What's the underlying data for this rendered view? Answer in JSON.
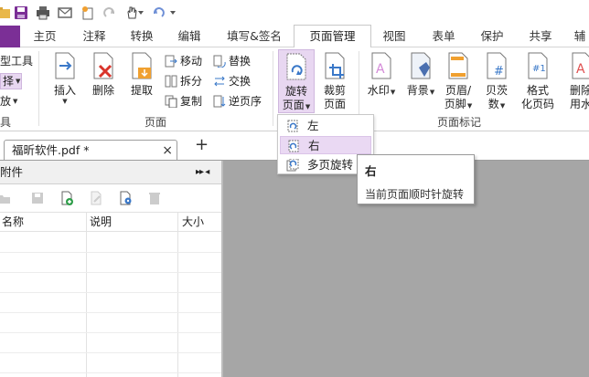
{
  "quick_access": {
    "icons": [
      "folder-icon",
      "save-icon",
      "print-icon",
      "email-icon",
      "new-icon",
      "redo-icon",
      "hand-tool-icon",
      "undo-icon",
      "dropdown-icon"
    ]
  },
  "menu": {
    "file_label": "",
    "tabs": [
      "主页",
      "注释",
      "转换",
      "编辑",
      "填写&签名",
      "页面管理",
      "视图",
      "表单",
      "保护",
      "共享",
      "辅"
    ],
    "active": "页面管理"
  },
  "ribbon": {
    "left_group": {
      "items": [
        "型工具",
        "择",
        "放"
      ],
      "label": "具"
    },
    "pages_group": {
      "insert": "插入",
      "delete": "删除",
      "extract": "提取",
      "move": "移动",
      "split": "拆分",
      "copy": "复制",
      "replace": "替换",
      "swap": "交换",
      "reverse": "逆页序",
      "label": "页面"
    },
    "rotate": {
      "line1": "旋转",
      "line2": "页面"
    },
    "crop": {
      "line1": "裁剪",
      "line2": "页面"
    },
    "marks_group": {
      "watermark": "水印",
      "background": "背景",
      "header_footer_1": "页眉/",
      "header_footer_2": "页脚",
      "bates_1": "贝茨",
      "bates_2": "数",
      "format_1": "格式",
      "format_2": "化页码",
      "remove_1": "删除",
      "remove_2": "用水",
      "label": "页面标记"
    }
  },
  "document_tab": {
    "title": "福昕软件.pdf *",
    "close": "×",
    "new": "+"
  },
  "panel": {
    "title": "附件",
    "controls": "▸▸ ◂",
    "columns": [
      "名称",
      "说明",
      "大小"
    ]
  },
  "dropdown": {
    "items": [
      "左",
      "右",
      "多页旋转"
    ],
    "selected_index": 1
  },
  "tooltip": {
    "title": "右",
    "description": "当前页面顺时针旋转"
  },
  "colors": {
    "accent": "#7b2f96",
    "highlight": "#ead9f3",
    "workspace": "#a6a6a6"
  }
}
